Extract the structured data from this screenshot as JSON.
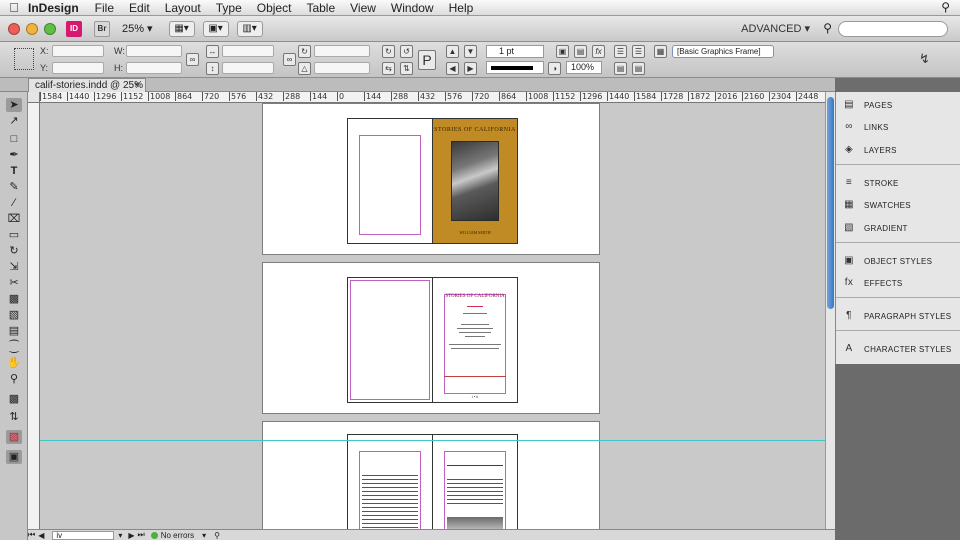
{
  "menubar": {
    "app_name": "InDesign",
    "items": [
      "File",
      "Edit",
      "Layout",
      "Type",
      "Object",
      "Table",
      "View",
      "Window",
      "Help"
    ]
  },
  "appbar": {
    "id_icon": "ID",
    "br_icon": "Br",
    "zoom": "25%",
    "workspace": "ADVANCED ▾"
  },
  "control": {
    "x_label": "X:",
    "y_label": "Y:",
    "w_label": "W:",
    "h_label": "H:",
    "stroke_weight": "1 pt",
    "zoom_percent": "100%",
    "frame_style": "[Basic Graphics Frame]"
  },
  "document_tab": {
    "title": "calif-stories.indd @ 25%",
    "close": "×"
  },
  "ruler_h": [
    "1584",
    "1440",
    "1296",
    "1152",
    "1008",
    "864",
    "720",
    "576",
    "432",
    "288",
    "144",
    "0",
    "144",
    "288",
    "432",
    "576",
    "720",
    "864",
    "1008",
    "1152",
    "1296",
    "1440",
    "1584",
    "1728",
    "1872",
    "2016",
    "2160",
    "2304",
    "2448"
  ],
  "pages": {
    "cover_title": "STORIES OF CALIFORNIA",
    "cover_author": "WILLIAM SMITH",
    "title_page_title": "STORIES OF CALIFORNIA",
    "page_number": "i • ii"
  },
  "status": {
    "page_field": "iv",
    "preflight": "No errors"
  },
  "panels": [
    {
      "label": "PAGES",
      "icon": "pages-icon"
    },
    {
      "label": "LINKS",
      "icon": "links-icon"
    },
    {
      "label": "LAYERS",
      "icon": "layers-icon"
    },
    {
      "label": "STROKE",
      "icon": "stroke-icon"
    },
    {
      "label": "SWATCHES",
      "icon": "swatches-icon"
    },
    {
      "label": "GRADIENT",
      "icon": "gradient-icon"
    },
    {
      "label": "OBJECT STYLES",
      "icon": "object-styles-icon"
    },
    {
      "label": "EFFECTS",
      "icon": "effects-icon"
    },
    {
      "label": "PARAGRAPH STYLES",
      "icon": "paragraph-styles-icon"
    },
    {
      "label": "CHARACTER STYLES",
      "icon": "character-styles-icon"
    }
  ],
  "colors": {
    "cover": "#c08b25",
    "margin_guide": "#c060c0",
    "ruler_guide": "#40c8c8",
    "indesign_brand": "#d6186e"
  }
}
